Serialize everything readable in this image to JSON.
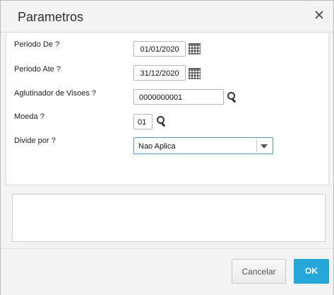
{
  "dialog": {
    "title": "Parametros"
  },
  "form": {
    "periodo_de": {
      "label": "Periodo De ?",
      "value": "01/01/2020",
      "icon": "calendar-icon"
    },
    "periodo_ate": {
      "label": "Periodo Ate ?",
      "value": "31/12/2020",
      "icon": "calendar-icon"
    },
    "aglutinador": {
      "label": "Aglutinador de Visoes ?",
      "value": "0000000001",
      "icon": "search-icon"
    },
    "moeda": {
      "label": "Moeda ?",
      "value": "01",
      "icon": "search-icon"
    },
    "divide_por": {
      "label": "Divide por ?",
      "value": "Nao Aplica"
    }
  },
  "footer": {
    "cancel_label": "Cancelar",
    "ok_label": "OK"
  },
  "colors": {
    "ok_button": "#24a6d8",
    "select_border": "#4a8fc6"
  }
}
